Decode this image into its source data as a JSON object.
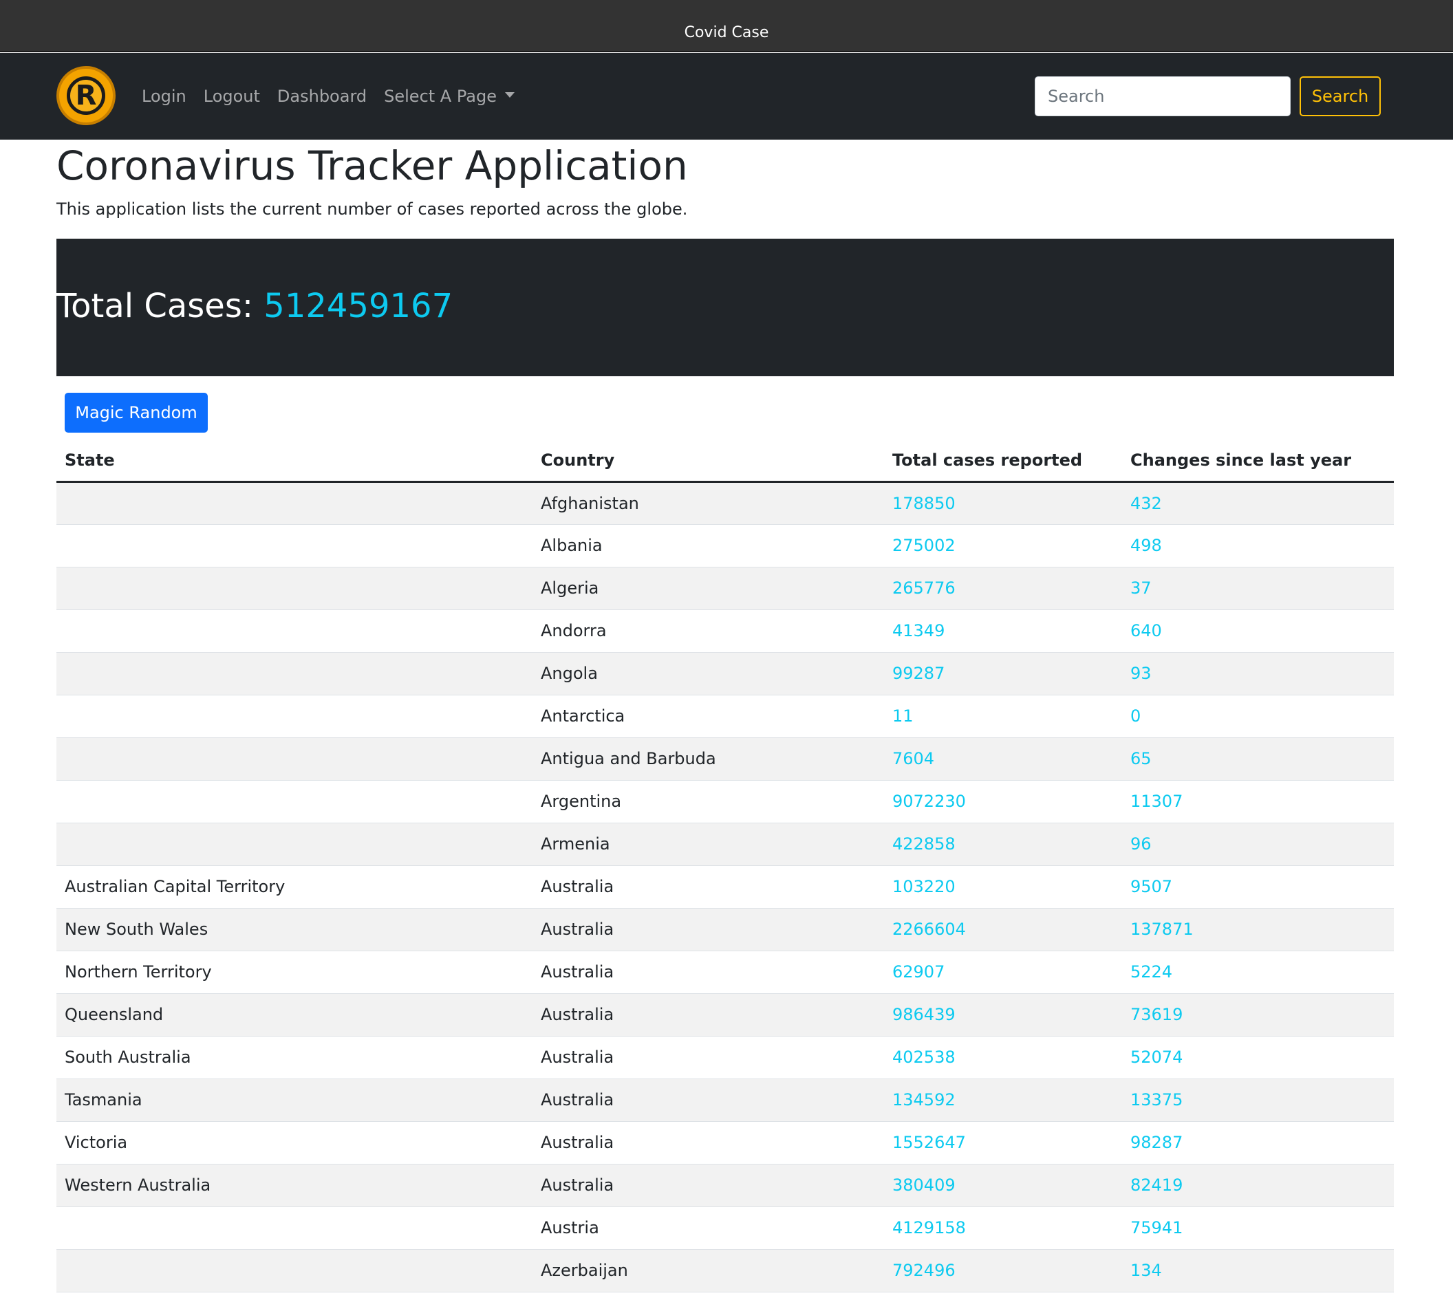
{
  "window": {
    "title": "Covid Case"
  },
  "navbar": {
    "logo_letter": "R",
    "links": [
      "Login",
      "Logout",
      "Dashboard"
    ],
    "dropdown_label": "Select A Page",
    "search_placeholder": "Search",
    "search_button": "Search"
  },
  "main": {
    "title": "Coronavirus Tracker Application",
    "lead": "This application lists the current number of cases reported across the globe.",
    "total_label": "Total Cases:",
    "total_value": "512459167",
    "magic_button": "Magic Random"
  },
  "table": {
    "headers": [
      "State",
      "Country",
      "Total cases reported",
      "Changes since last year"
    ],
    "rows": [
      [
        "",
        "Afghanistan",
        "178850",
        "432"
      ],
      [
        "",
        "Albania",
        "275002",
        "498"
      ],
      [
        "",
        "Algeria",
        "265776",
        "37"
      ],
      [
        "",
        "Andorra",
        "41349",
        "640"
      ],
      [
        "",
        "Angola",
        "99287",
        "93"
      ],
      [
        "",
        "Antarctica",
        "11",
        "0"
      ],
      [
        "",
        "Antigua and Barbuda",
        "7604",
        "65"
      ],
      [
        "",
        "Argentina",
        "9072230",
        "11307"
      ],
      [
        "",
        "Armenia",
        "422858",
        "96"
      ],
      [
        "Australian Capital Territory",
        "Australia",
        "103220",
        "9507"
      ],
      [
        "New South Wales",
        "Australia",
        "2266604",
        "137871"
      ],
      [
        "Northern Territory",
        "Australia",
        "62907",
        "5224"
      ],
      [
        "Queensland",
        "Australia",
        "986439",
        "73619"
      ],
      [
        "South Australia",
        "Australia",
        "402538",
        "52074"
      ],
      [
        "Tasmania",
        "Australia",
        "134592",
        "13375"
      ],
      [
        "Victoria",
        "Australia",
        "1552647",
        "98287"
      ],
      [
        "Western Australia",
        "Australia",
        "380409",
        "82419"
      ],
      [
        "",
        "Austria",
        "4129158",
        "75941"
      ],
      [
        "",
        "Azerbaijan",
        "792496",
        "134"
      ]
    ]
  },
  "colors": {
    "navbar_bg": "#212529",
    "accent_info": "#0dcaf0",
    "warning": "#ffc107",
    "primary": "#0d6efd"
  }
}
